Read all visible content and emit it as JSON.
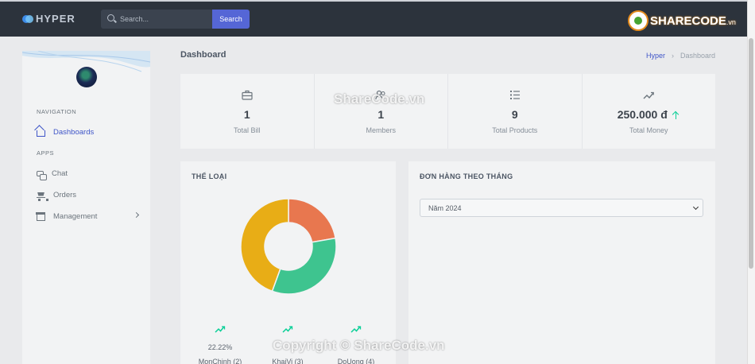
{
  "header": {
    "logo_text": "HYPER",
    "search_placeholder": "Search...",
    "search_button": "Search",
    "brand_badge": "SHARECODE",
    "brand_badge_suffix": ".vn"
  },
  "sidebar": {
    "nav_heading": "NAVIGATION",
    "apps_heading": "APPS",
    "items": [
      {
        "label": "Dashboards",
        "icon": "home-icon",
        "active": true
      },
      {
        "label": "Chat",
        "icon": "chat-icon"
      },
      {
        "label": "Orders",
        "icon": "cart-icon"
      },
      {
        "label": "Management",
        "icon": "store-icon",
        "has_submenu": true
      }
    ]
  },
  "page": {
    "title": "Dashboard",
    "breadcrumb": {
      "root": "Hyper",
      "current": "Dashboard"
    }
  },
  "stats": [
    {
      "value": "1",
      "label": "Total Bill",
      "icon": "briefcase-icon"
    },
    {
      "value": "1",
      "label": "Members",
      "icon": "users-icon"
    },
    {
      "value": "9",
      "label": "Total Products",
      "icon": "list-icon"
    },
    {
      "value": "250.000 đ",
      "label": "Total Money",
      "icon": "trending-up-icon",
      "trend": "up"
    }
  ],
  "category_card": {
    "title": "THỂ LOẠI",
    "legend": [
      {
        "pct": "22.22%",
        "name": "MonChinh (2)"
      },
      {
        "pct": "",
        "name": "KhaiVi (3)"
      },
      {
        "pct": "",
        "name": "DoUong (4)"
      }
    ]
  },
  "chart_data": {
    "type": "pie",
    "title": "THỂ LOẠI",
    "categories": [
      "MonChinh",
      "KhaiVi",
      "DoUong"
    ],
    "values": [
      2,
      3,
      4
    ],
    "colors": [
      "#e8774f",
      "#3ec48f",
      "#e8ad16"
    ]
  },
  "orders_card": {
    "title": "ĐƠN HÀNG THEO THÁNG",
    "year_select": "Năm 2024"
  },
  "watermarks": {
    "top": "ShareCode.vn",
    "bottom": "Copyright © ShareCode.vn"
  }
}
